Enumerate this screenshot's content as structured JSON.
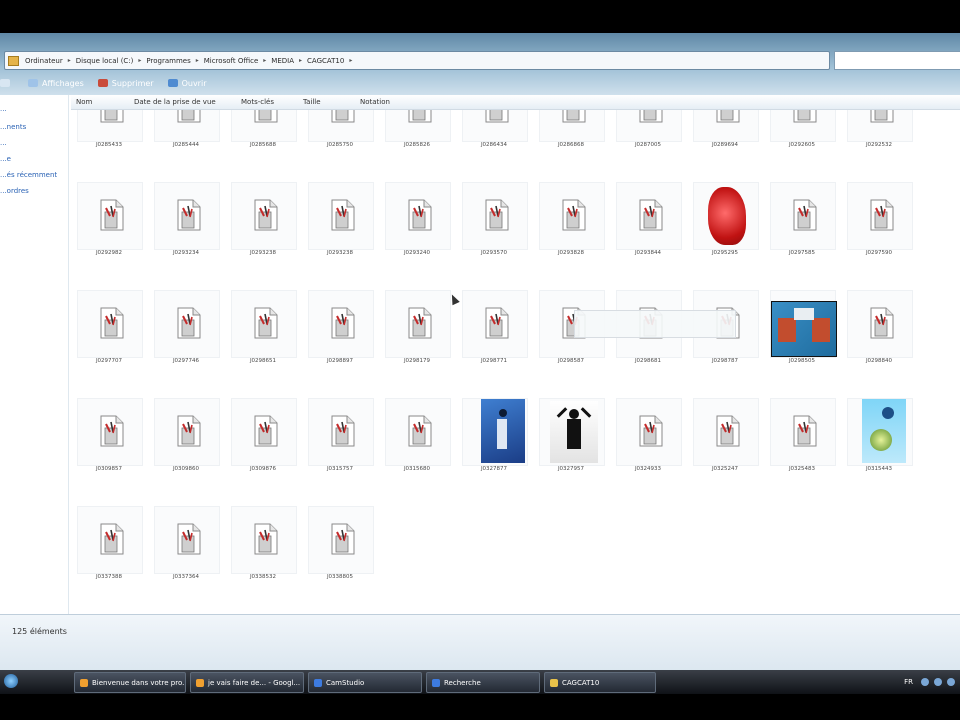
{
  "window": {
    "breadcrumbs": [
      "Ordinateur",
      "Disque local (C:)",
      "Programmes",
      "Microsoft Office",
      "MEDIA",
      "CAGCAT10"
    ],
    "toolbar": {
      "organize_label": "",
      "views_label": "Affichages",
      "delete_label": "Supprimer",
      "open_label": "Ouvrir"
    },
    "sidebar_items": [
      "...",
      "...nents",
      "...",
      "...e",
      "...és récemment",
      "...ordres"
    ],
    "columns": [
      "Nom",
      "Date de la prise de vue",
      "Mots-clés",
      "Taille",
      "Notation"
    ],
    "files": [
      {
        "name": "J0285433",
        "kind": "placeholder"
      },
      {
        "name": "J0285444",
        "kind": "placeholder"
      },
      {
        "name": "J0285688",
        "kind": "placeholder"
      },
      {
        "name": "J0285750",
        "kind": "placeholder"
      },
      {
        "name": "J0285826",
        "kind": "placeholder"
      },
      {
        "name": "J0286434",
        "kind": "placeholder"
      },
      {
        "name": "J0286868",
        "kind": "placeholder"
      },
      {
        "name": "J0287005",
        "kind": "placeholder"
      },
      {
        "name": "J0289694",
        "kind": "placeholder"
      },
      {
        "name": "J0292605",
        "kind": "placeholder"
      },
      {
        "name": "J0292532",
        "kind": "placeholder"
      },
      {
        "name": "J0292982",
        "kind": "placeholder"
      },
      {
        "name": "J0293234",
        "kind": "placeholder"
      },
      {
        "name": "J0293238",
        "kind": "placeholder"
      },
      {
        "name": "J0293238",
        "kind": "placeholder"
      },
      {
        "name": "J0293240",
        "kind": "placeholder"
      },
      {
        "name": "J0293570",
        "kind": "placeholder"
      },
      {
        "name": "J0293828",
        "kind": "placeholder"
      },
      {
        "name": "J0293844",
        "kind": "placeholder"
      },
      {
        "name": "J0295295",
        "kind": "red-shape"
      },
      {
        "name": "J0297585",
        "kind": "placeholder"
      },
      {
        "name": "J0297590",
        "kind": "placeholder"
      },
      {
        "name": "J0297707",
        "kind": "placeholder"
      },
      {
        "name": "J0297746",
        "kind": "placeholder"
      },
      {
        "name": "J0298651",
        "kind": "placeholder"
      },
      {
        "name": "J0298897",
        "kind": "placeholder"
      },
      {
        "name": "J0298179",
        "kind": "placeholder"
      },
      {
        "name": "J0298771",
        "kind": "placeholder"
      },
      {
        "name": "J0298587",
        "kind": "placeholder"
      },
      {
        "name": "J0298681",
        "kind": "placeholder"
      },
      {
        "name": "J0298787",
        "kind": "placeholder"
      },
      {
        "name": "J0298505",
        "kind": "computers"
      },
      {
        "name": "J0298840",
        "kind": "placeholder"
      },
      {
        "name": "J0309857",
        "kind": "placeholder"
      },
      {
        "name": "J0309860",
        "kind": "placeholder"
      },
      {
        "name": "J0309876",
        "kind": "placeholder"
      },
      {
        "name": "J0315757",
        "kind": "placeholder"
      },
      {
        "name": "J0315680",
        "kind": "placeholder"
      },
      {
        "name": "J0327877",
        "kind": "blue-figure"
      },
      {
        "name": "J0327957",
        "kind": "silhouette"
      },
      {
        "name": "J0324933",
        "kind": "placeholder"
      },
      {
        "name": "J0325247",
        "kind": "placeholder"
      },
      {
        "name": "J0325483",
        "kind": "placeholder"
      },
      {
        "name": "J0315443",
        "kind": "globe-art"
      },
      {
        "name": "J0337388",
        "kind": "placeholder"
      },
      {
        "name": "J0337364",
        "kind": "placeholder"
      },
      {
        "name": "J0338532",
        "kind": "placeholder"
      },
      {
        "name": "J0338805",
        "kind": "placeholder"
      }
    ],
    "status_text": "125 éléments"
  },
  "taskbar": {
    "buttons": [
      {
        "label": "Bienvenue dans votre pro...",
        "color": "#f0a030"
      },
      {
        "label": "je vais faire de... - Googl...",
        "color": "#f0a030"
      },
      {
        "label": "CamStudio",
        "color": "#3d7be0"
      },
      {
        "label": "Recherche",
        "color": "#3d7be0"
      },
      {
        "label": "CAGCAT10",
        "color": "#e8c24a"
      }
    ],
    "tray_text": "FR"
  }
}
